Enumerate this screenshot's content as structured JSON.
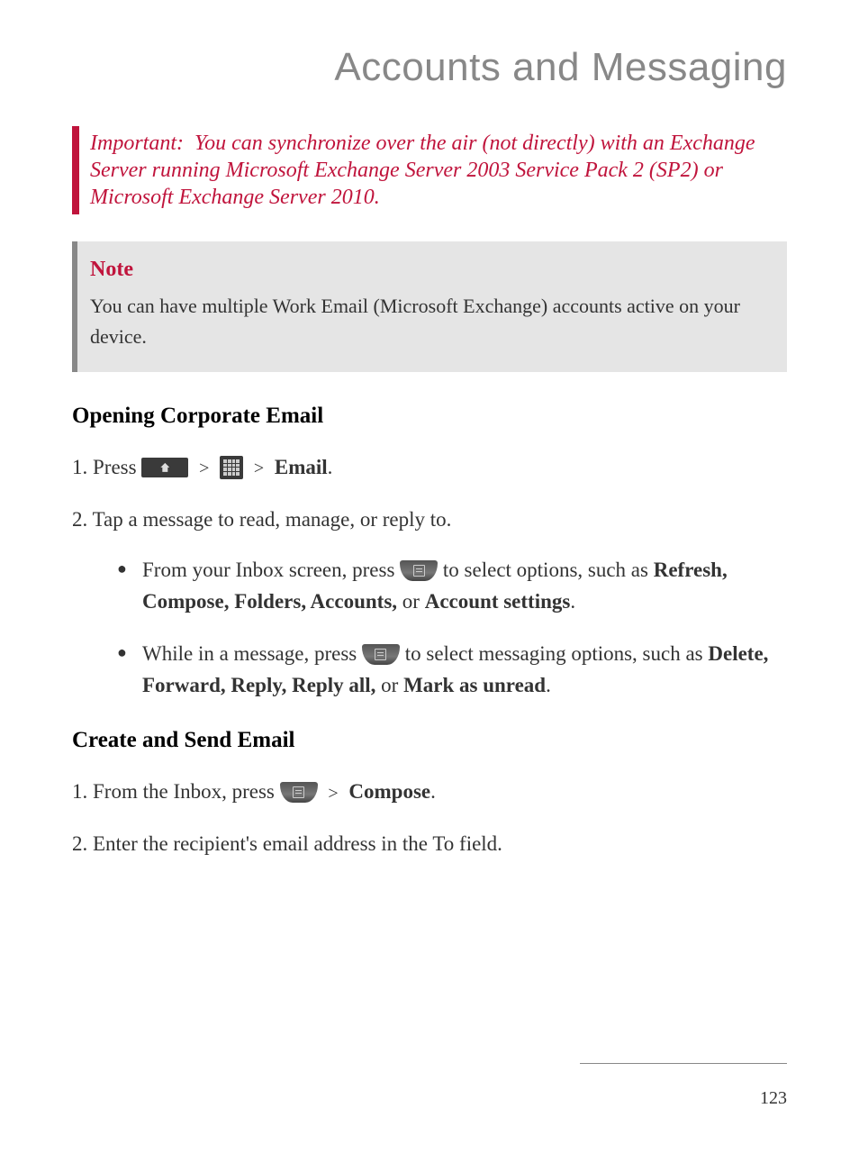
{
  "title": "Accounts and Messaging",
  "important": {
    "label": "Important:",
    "text": "You can synchronize over the air (not directly) with an Exchange Server running Microsoft Exchange Server 2003 Service Pack 2 (SP2) or Microsoft Exchange Server 2010."
  },
  "note": {
    "title": "Note",
    "body": "You can have multiple Work Email (Microsoft Exchange) accounts active on your device."
  },
  "section1": {
    "heading": "Opening Corporate Email",
    "step1_prefix": "1. Press ",
    "step1_gt1": ">",
    "step1_gt2": ">",
    "step1_bold": "Email",
    "step1_period": ".",
    "step2": "2. Tap a message to read, manage, or reply to.",
    "bullet1_pre": "From your Inbox screen, press ",
    "bullet1_post1": " to select options, such as ",
    "bullet1_bold": "Refresh, Compose, Folders, Accounts,",
    "bullet1_or": " or ",
    "bullet1_bold2": "Account settings",
    "bullet1_period": ".",
    "bullet2_pre": "While in a message, press ",
    "bullet2_post1": " to select messaging options, such as ",
    "bullet2_bold": "Delete, Forward, Reply, Reply all,",
    "bullet2_or": " or ",
    "bullet2_bold2": "Mark as unread",
    "bullet2_period": "."
  },
  "section2": {
    "heading": "Create and Send Email",
    "step1_prefix": "1. From the Inbox, press ",
    "step1_gt": ">",
    "step1_bold": "Compose",
    "step1_period": ".",
    "step2": "2. Enter the recipient's email address in the To field."
  },
  "page_number": "123"
}
